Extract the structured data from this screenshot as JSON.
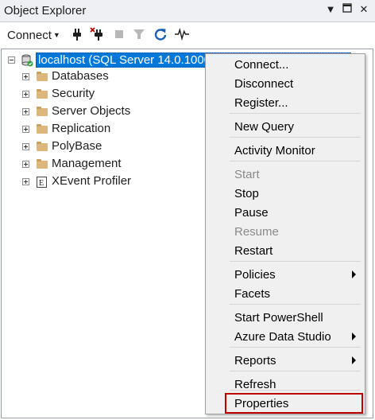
{
  "window": {
    "title": "Object Explorer",
    "controls": [
      "pin-dropdown-icon",
      "maximize-icon",
      "close-icon"
    ]
  },
  "toolbar": {
    "connect_label": "Connect",
    "icons": [
      "connect-plug-icon",
      "disconnect-plug-icon",
      "stop-icon",
      "filter-icon",
      "refresh-icon",
      "activity-monitor-icon"
    ]
  },
  "tree": {
    "server": "localhost (SQL Server 14.0.1000",
    "nodes": [
      {
        "label": "Databases",
        "icon": "folder-icon"
      },
      {
        "label": "Security",
        "icon": "folder-icon"
      },
      {
        "label": "Server Objects",
        "icon": "folder-icon"
      },
      {
        "label": "Replication",
        "icon": "folder-icon"
      },
      {
        "label": "PolyBase",
        "icon": "folder-icon"
      },
      {
        "label": "Management",
        "icon": "folder-icon"
      },
      {
        "label": "XEvent Profiler",
        "icon": "xevent-profiler-icon"
      }
    ]
  },
  "context_menu": {
    "items": [
      {
        "label": "Connect...",
        "enabled": true
      },
      {
        "label": "Disconnect",
        "enabled": true
      },
      {
        "label": "Register...",
        "enabled": true
      },
      {
        "label": "New Query",
        "enabled": true
      },
      {
        "label": "Activity Monitor",
        "enabled": true
      },
      {
        "label": "Start",
        "enabled": false
      },
      {
        "label": "Stop",
        "enabled": true
      },
      {
        "label": "Pause",
        "enabled": true
      },
      {
        "label": "Resume",
        "enabled": false
      },
      {
        "label": "Restart",
        "enabled": true
      },
      {
        "label": "Policies",
        "enabled": true,
        "submenu": true
      },
      {
        "label": "Facets",
        "enabled": true
      },
      {
        "label": "Start PowerShell",
        "enabled": true
      },
      {
        "label": "Azure Data Studio",
        "enabled": true,
        "submenu": true
      },
      {
        "label": "Reports",
        "enabled": true,
        "submenu": true
      },
      {
        "label": "Refresh",
        "enabled": true
      },
      {
        "label": "Properties",
        "enabled": true,
        "highlighted": true
      }
    ]
  },
  "colors": {
    "selection": "#0078d7",
    "highlight_border": "#c00000",
    "folder": "#dcb67a",
    "disabled_text": "#8a8a8a"
  }
}
